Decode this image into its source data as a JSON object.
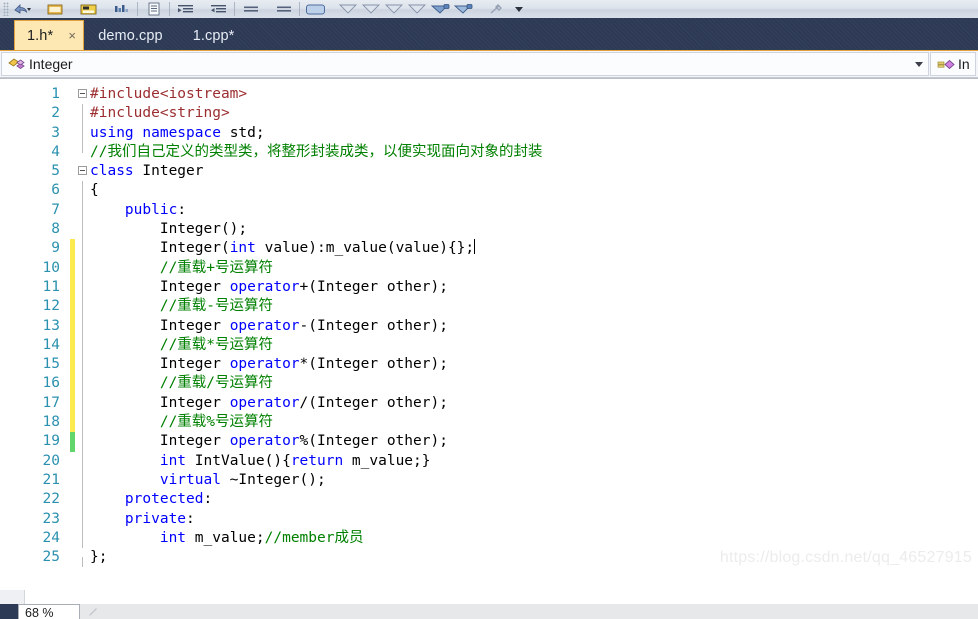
{
  "toolbar": {
    "buttons": [
      {
        "name": "undo-dropdown-icon",
        "glyph": "undo"
      },
      {
        "name": "open-file-icon",
        "glyph": "folder"
      },
      {
        "name": "save-all-icon",
        "glyph": "save"
      },
      {
        "name": "find-icon",
        "glyph": "bars"
      },
      {
        "name": "comment-block-icon",
        "glyph": "lines"
      },
      {
        "name": "indent-decrease-icon",
        "glyph": "indent-left"
      },
      {
        "name": "indent-increase-icon",
        "glyph": "indent-right"
      },
      {
        "name": "align-icon-1",
        "glyph": "align"
      },
      {
        "name": "align-icon-2",
        "glyph": "align"
      },
      {
        "name": "window-icon",
        "glyph": "window"
      },
      {
        "name": "nav-back-icon-1",
        "glyph": "arrow"
      },
      {
        "name": "nav-back-icon-2",
        "glyph": "arrow"
      },
      {
        "name": "nav-back-icon-3",
        "glyph": "arrow"
      },
      {
        "name": "nav-back-icon-4",
        "glyph": "arrow"
      },
      {
        "name": "nav-fwd-icon-1",
        "glyph": "arrow-blue"
      },
      {
        "name": "nav-fwd-icon-2",
        "glyph": "arrow-blue"
      },
      {
        "name": "toolbar-tool-icon",
        "glyph": "wrench"
      }
    ],
    "overflow_label": "toolbar-overflow"
  },
  "tabs": [
    {
      "label": "1.h*",
      "active": true,
      "close": "×"
    },
    {
      "label": "demo.cpp",
      "active": false
    },
    {
      "label": "1.cpp*",
      "active": false
    }
  ],
  "navbar": {
    "class_scope": "Integer",
    "class_icon": "class-icon",
    "member_scope": "In",
    "member_icon": "method-icon"
  },
  "editor": {
    "watermark": "https://blog.csdn.net/qq_46527915",
    "lines": [
      {
        "n": "1",
        "change": "none",
        "fold": true,
        "guide": "",
        "tokens": [
          {
            "t": "#include<iostream>",
            "c": "pp"
          }
        ]
      },
      {
        "n": "2",
        "change": "none",
        "fold": false,
        "guide": "full",
        "tokens": [
          {
            "t": "#include<string>",
            "c": "pp"
          }
        ]
      },
      {
        "n": "3",
        "change": "none",
        "fold": false,
        "guide": "full",
        "tokens": [
          {
            "t": "using",
            "c": "kw"
          },
          {
            "t": " ",
            "c": "plain"
          },
          {
            "t": "namespace",
            "c": "kw"
          },
          {
            "t": " std;",
            "c": "plain"
          }
        ]
      },
      {
        "n": "4",
        "change": "none",
        "fold": false,
        "guide": "half-bot",
        "tokens": [
          {
            "t": "//我们自己定义的类型类，将整形封装成类，以便实现面向对象的封装",
            "c": "cmt"
          }
        ]
      },
      {
        "n": "5",
        "change": "none",
        "fold": true,
        "guide": "",
        "tokens": [
          {
            "t": "class",
            "c": "kw"
          },
          {
            "t": " Integer",
            "c": "plain"
          }
        ]
      },
      {
        "n": "6",
        "change": "none",
        "fold": false,
        "guide": "full",
        "tokens": [
          {
            "t": "{",
            "c": "plain"
          }
        ]
      },
      {
        "n": "7",
        "change": "none",
        "fold": false,
        "guide": "full",
        "tokens": [
          {
            "t": "    ",
            "c": "plain"
          },
          {
            "t": "public",
            "c": "kw"
          },
          {
            "t": ":",
            "c": "plain"
          }
        ]
      },
      {
        "n": "8",
        "change": "none",
        "fold": false,
        "guide": "full",
        "tokens": [
          {
            "t": "        Integer();",
            "c": "plain"
          }
        ]
      },
      {
        "n": "9",
        "change": "yellow",
        "fold": false,
        "guide": "full",
        "caret": true,
        "tokens": [
          {
            "t": "        Integer(",
            "c": "plain"
          },
          {
            "t": "int",
            "c": "kw"
          },
          {
            "t": " value):m_value(value){};",
            "c": "plain"
          }
        ]
      },
      {
        "n": "10",
        "change": "yellow",
        "fold": false,
        "guide": "full",
        "tokens": [
          {
            "t": "        //重载+号运算符",
            "c": "cmt"
          }
        ]
      },
      {
        "n": "11",
        "change": "yellow",
        "fold": false,
        "guide": "full",
        "tokens": [
          {
            "t": "        Integer ",
            "c": "plain"
          },
          {
            "t": "operator",
            "c": "kw"
          },
          {
            "t": "+(Integer other);",
            "c": "plain"
          }
        ]
      },
      {
        "n": "12",
        "change": "yellow",
        "fold": false,
        "guide": "full",
        "tokens": [
          {
            "t": "        //重载-号运算符",
            "c": "cmt"
          }
        ]
      },
      {
        "n": "13",
        "change": "yellow",
        "fold": false,
        "guide": "full",
        "tokens": [
          {
            "t": "        Integer ",
            "c": "plain"
          },
          {
            "t": "operator",
            "c": "kw"
          },
          {
            "t": "-(Integer other);",
            "c": "plain"
          }
        ]
      },
      {
        "n": "14",
        "change": "yellow",
        "fold": false,
        "guide": "full",
        "tokens": [
          {
            "t": "        //重载*号运算符",
            "c": "cmt"
          }
        ]
      },
      {
        "n": "15",
        "change": "yellow",
        "fold": false,
        "guide": "full",
        "tokens": [
          {
            "t": "        Integer ",
            "c": "plain"
          },
          {
            "t": "operator",
            "c": "kw"
          },
          {
            "t": "*(Integer other);",
            "c": "plain"
          }
        ]
      },
      {
        "n": "16",
        "change": "yellow",
        "fold": false,
        "guide": "full",
        "tokens": [
          {
            "t": "        //重载/号运算符",
            "c": "cmt"
          }
        ]
      },
      {
        "n": "17",
        "change": "yellow",
        "fold": false,
        "guide": "full",
        "tokens": [
          {
            "t": "        Integer ",
            "c": "plain"
          },
          {
            "t": "operator",
            "c": "kw"
          },
          {
            "t": "/(Integer other);",
            "c": "plain"
          }
        ]
      },
      {
        "n": "18",
        "change": "yellow",
        "fold": false,
        "guide": "full",
        "tokens": [
          {
            "t": "        //重载%号运算符",
            "c": "cmt"
          }
        ]
      },
      {
        "n": "19",
        "change": "green",
        "fold": false,
        "guide": "full",
        "tokens": [
          {
            "t": "        Integer ",
            "c": "plain"
          },
          {
            "t": "operator",
            "c": "kw"
          },
          {
            "t": "%(Integer other);",
            "c": "plain"
          }
        ]
      },
      {
        "n": "20",
        "change": "none",
        "fold": false,
        "guide": "full",
        "tokens": [
          {
            "t": "        ",
            "c": "plain"
          },
          {
            "t": "int",
            "c": "kw"
          },
          {
            "t": " IntValue(){",
            "c": "plain"
          },
          {
            "t": "return",
            "c": "kw"
          },
          {
            "t": " m_value;}",
            "c": "plain"
          }
        ]
      },
      {
        "n": "21",
        "change": "none",
        "fold": false,
        "guide": "full",
        "tokens": [
          {
            "t": "        ",
            "c": "plain"
          },
          {
            "t": "virtual",
            "c": "kw"
          },
          {
            "t": " ~Integer();",
            "c": "plain"
          }
        ]
      },
      {
        "n": "22",
        "change": "none",
        "fold": false,
        "guide": "full",
        "tokens": [
          {
            "t": "    ",
            "c": "plain"
          },
          {
            "t": "protected",
            "c": "kw"
          },
          {
            "t": ":",
            "c": "plain"
          }
        ]
      },
      {
        "n": "23",
        "change": "none",
        "fold": false,
        "guide": "full",
        "tokens": [
          {
            "t": "    ",
            "c": "plain"
          },
          {
            "t": "private",
            "c": "kw"
          },
          {
            "t": ":",
            "c": "plain"
          }
        ]
      },
      {
        "n": "24",
        "change": "none",
        "fold": false,
        "guide": "full",
        "tokens": [
          {
            "t": "        ",
            "c": "plain"
          },
          {
            "t": "int",
            "c": "kw"
          },
          {
            "t": " m_value;",
            "c": "plain"
          },
          {
            "t": "//member成员",
            "c": "cmt"
          }
        ]
      },
      {
        "n": "25",
        "change": "none",
        "fold": false,
        "guide": "half-top",
        "tokens": [
          {
            "t": "};",
            "c": "plain"
          }
        ]
      }
    ]
  },
  "status": {
    "zoom_level": "68 %"
  },
  "colors": {
    "tabbar_bg": "#2d3a55",
    "active_tab_bg": "#fde8b4",
    "accent_gold": "#e2a33c",
    "keyword": "#0000ff",
    "preprocessor": "#9b2d30",
    "comment": "#008000",
    "line_number": "#2b91af",
    "change_modified": "#fcea4f",
    "change_saved": "#62d66a"
  }
}
